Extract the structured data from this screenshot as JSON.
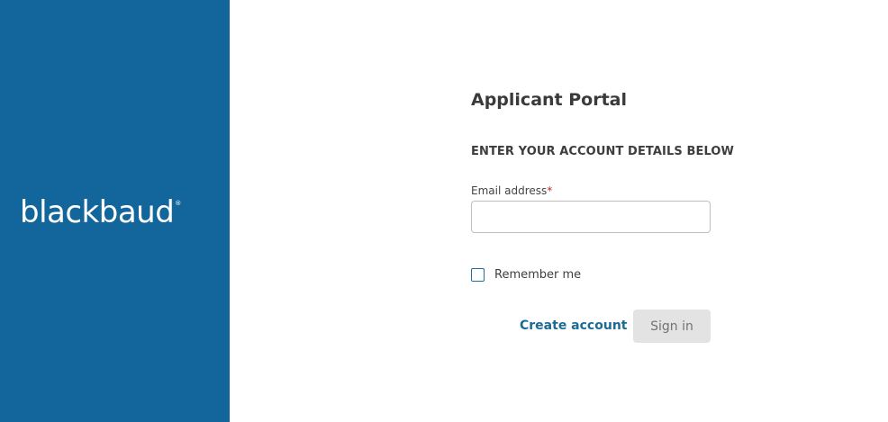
{
  "brand": {
    "logo_text": "blackbaud",
    "logo_mark": "®",
    "panel_color": "#13669c"
  },
  "form": {
    "title": "Applicant Portal",
    "section_heading": "ENTER YOUR ACCOUNT DETAILS BELOW",
    "email": {
      "label": "Email address",
      "required_marker": "*",
      "value": "",
      "placeholder": ""
    },
    "remember_me": {
      "label": "Remember me",
      "checked": false
    },
    "create_account_label": "Create account",
    "sign_in_label": "Sign in"
  },
  "colors": {
    "link": "#1b6b97",
    "required": "#c12828",
    "button_disabled_bg": "#e3e3e3"
  }
}
